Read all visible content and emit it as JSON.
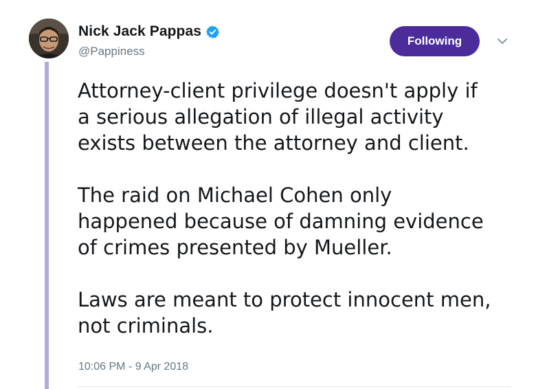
{
  "author": {
    "display_name": "Nick Jack Pappas",
    "handle": "@Pappiness",
    "verified": true,
    "avatar_icon": "user-avatar"
  },
  "actions": {
    "follow_label": "Following",
    "more_icon": "chevron-down-icon",
    "accent_color": "#4b2c9a"
  },
  "tweet": {
    "paragraphs": [
      {
        "lines": [
          "Attorney-client privilege doesn't apply if",
          "a serious allegation of illegal activity",
          "exists between the attorney and client."
        ]
      },
      {
        "lines": [
          "The raid on Michael Cohen only",
          "happened because of damning evidence",
          "of crimes presented by Mueller."
        ]
      },
      {
        "lines": [
          "Laws are meant to protect innocent men,",
          "not criminals."
        ]
      }
    ],
    "timestamp": "10:06 PM - 9 Apr 2018"
  }
}
